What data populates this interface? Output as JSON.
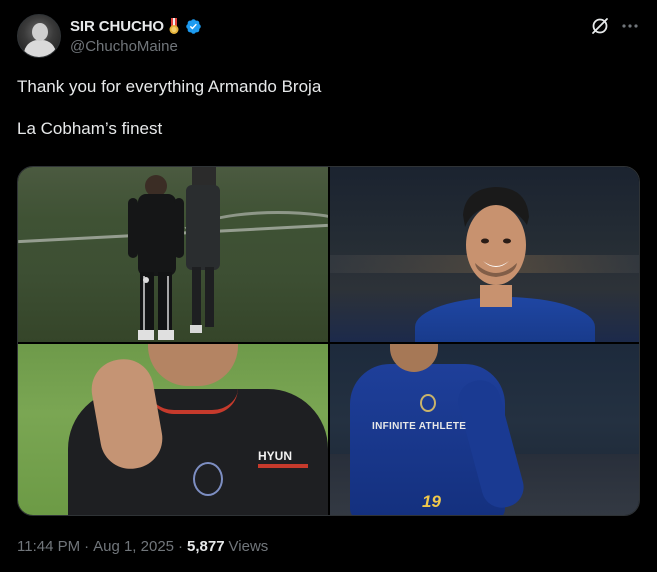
{
  "author": {
    "display_name": "SIR CHUCHO",
    "handle": "@ChuchoMaine",
    "verified": true,
    "badge_emoji": "medal-icon"
  },
  "tweet": {
    "lines": [
      "Thank you for everything Armando Broja",
      "La Cobham’s finest"
    ]
  },
  "media": {
    "count": 4,
    "tiles": [
      {
        "label": "photo-1"
      },
      {
        "label": "photo-2"
      },
      {
        "label": "photo-3",
        "visible_text": [
          "HYUN"
        ]
      },
      {
        "label": "photo-4",
        "visible_text": [
          "INFINITE ATHLETE",
          "19"
        ]
      }
    ]
  },
  "meta": {
    "time": "11:44 PM",
    "separator": "·",
    "date": "Aug 1, 2025",
    "views_count": "5,877",
    "views_label": "Views"
  },
  "colors": {
    "background": "#000000",
    "text_primary": "#e7e9ea",
    "text_secondary": "#71767b",
    "verified_blue": "#1d9bf0",
    "border": "#2f3336"
  }
}
